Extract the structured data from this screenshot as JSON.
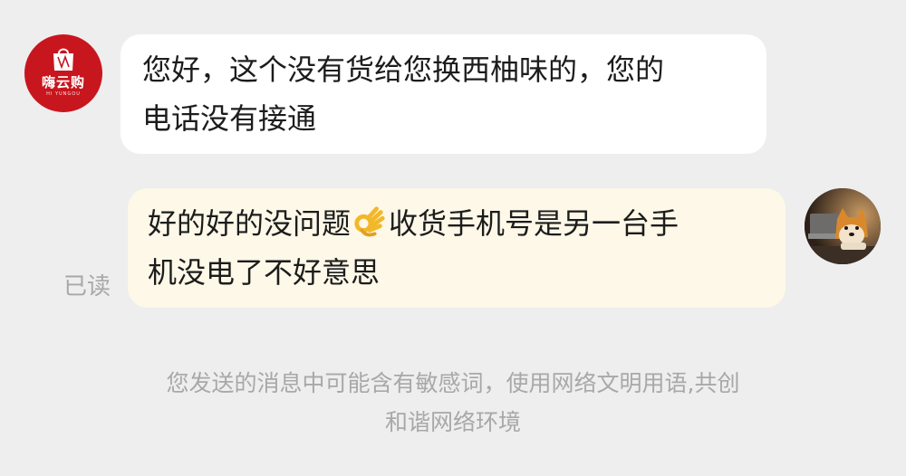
{
  "shop": {
    "logo_text": "嗨云购",
    "logo_subtext": "HI YUNGOU",
    "avatar_color": "#c8161e"
  },
  "messages": [
    {
      "sender": "shop",
      "lines": [
        "您好，这个没有货给您换西柚味的，您的",
        "电话没有接通"
      ]
    },
    {
      "sender": "user",
      "line1_before": "好的好的没问题",
      "emoji": "ok-hand",
      "line1_after": "收货手机号是另一台手",
      "line2": "机没电了不好意思",
      "status": "已读"
    }
  ],
  "notice": {
    "line1": "您发送的消息中可能含有敏感词，使用网络文明用语,共创",
    "line2": "和谐网络环境"
  },
  "colors": {
    "background": "#eeeeee",
    "incoming_bubble": "#ffffff",
    "outgoing_bubble": "#fdf8e8",
    "muted_text": "#a8a8a8"
  }
}
